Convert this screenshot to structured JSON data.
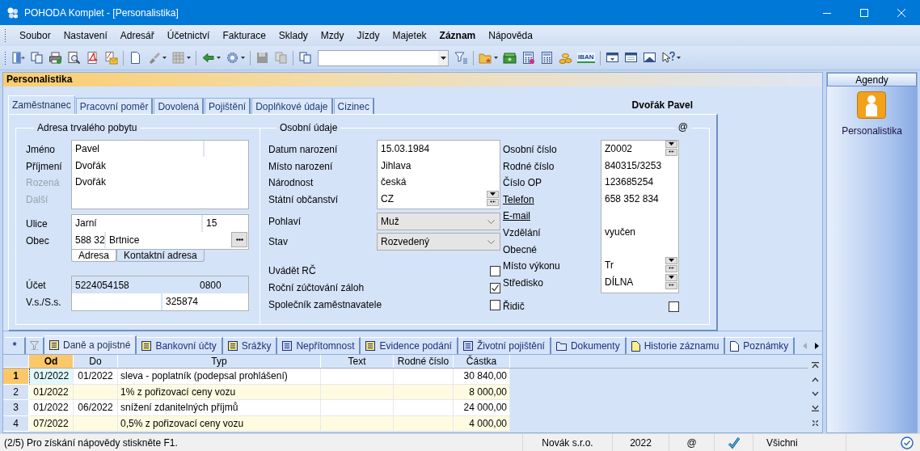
{
  "window": {
    "title": "POHODA Komplet - [Personalistika]"
  },
  "menu": [
    {
      "label": "Soubor",
      "emphasized": false
    },
    {
      "label": "Nastavení",
      "emphasized": false
    },
    {
      "label": "Adresář",
      "emphasized": false
    },
    {
      "label": "Účetnictví",
      "emphasized": false
    },
    {
      "label": "Fakturace",
      "emphasized": false
    },
    {
      "label": "Sklady",
      "emphasized": false
    },
    {
      "label": "Mzdy",
      "emphasized": false
    },
    {
      "label": "Jízdy",
      "emphasized": false
    },
    {
      "label": "Majetek",
      "emphasized": false
    },
    {
      "label": "Záznam",
      "emphasized": true
    },
    {
      "label": "Nápověda",
      "emphasized": false
    }
  ],
  "toolbar": {
    "iban_label": "IBAN"
  },
  "agenda_title": "Personalistika",
  "tabs": [
    {
      "label": "Zaměstnanec",
      "selected": true
    },
    {
      "label": "Pracovní poměr",
      "selected": false
    },
    {
      "label": "Dovolená",
      "selected": false
    },
    {
      "label": "Pojištění",
      "selected": false
    },
    {
      "label": "Doplňkové údaje",
      "selected": false
    },
    {
      "label": "Cizinec",
      "selected": false
    }
  ],
  "employee_name": "Dvořák Pavel",
  "address": {
    "title": "Adresa trvalého pobytu",
    "name_rows": [
      {
        "label": "Jméno",
        "disabled": false,
        "value": "Pavel"
      },
      {
        "label": "Příjmení",
        "disabled": false,
        "value": "Dvořák"
      },
      {
        "label": "Rozená",
        "disabled": true,
        "value": "Dvořák"
      },
      {
        "label": "Další",
        "disabled": true
      }
    ],
    "street_label": "Ulice",
    "street": "Jarní",
    "house_number": "15",
    "city_label": "Obec",
    "zip": "588 32",
    "city": "Brtnice",
    "subtabs": [
      {
        "label": "Adresa",
        "selected": true
      },
      {
        "label": "Kontaktní adresa",
        "selected": false
      }
    ],
    "account_label": "Účet",
    "account": "5224054158",
    "bank_code": "0800",
    "symbol_label": "V.s./S.s.",
    "specific_symbol": "325874"
  },
  "personal": {
    "title": "Osobní údaje",
    "marker": "@",
    "fields": [
      {
        "label": "Datum narození",
        "value": "15.03.1984",
        "picker": false
      },
      {
        "label": "Místo narození",
        "value": "Jihlava",
        "picker": false
      },
      {
        "label": "Národnost",
        "value": "česká",
        "picker": false
      },
      {
        "label": "Státní občanství",
        "value": "CZ",
        "picker": true
      }
    ],
    "selects": [
      {
        "label": "Pohlaví",
        "value": "Muž"
      },
      {
        "label": "Stav",
        "value": "Rozvedený"
      }
    ],
    "checks": [
      {
        "label": "Uvádět RČ",
        "checked": false
      },
      {
        "label": "Roční zúčtování záloh",
        "checked": true
      },
      {
        "label": "Společník zaměstnavatele",
        "checked": false
      }
    ]
  },
  "identity": {
    "fields": [
      {
        "label": "Osobní číslo",
        "value": "Z0002",
        "picker": true,
        "link": false
      },
      {
        "label": "Rodné číslo",
        "value": "840315/3253",
        "picker": false,
        "link": false
      },
      {
        "label": "Číslo OP",
        "value": "123685254",
        "picker": false,
        "link": false
      },
      {
        "label": "Telefon",
        "value": "658 352 834",
        "picker": false,
        "link": true
      },
      {
        "label": "E-mail",
        "picker": false,
        "link": true
      },
      {
        "label": "Vzdělání",
        "value": "vyučen",
        "picker": false,
        "link": false
      },
      {
        "label": "Obecné",
        "picker": false,
        "link": false
      },
      {
        "label": "Místo výkonu",
        "value": "Tr",
        "picker": true,
        "link": false
      },
      {
        "label": "Středisko",
        "value": "DÍLNA",
        "picker": true,
        "link": false
      }
    ],
    "checks": [
      {
        "label": "Řidič",
        "checked": false
      }
    ]
  },
  "bottom_tabs": {
    "new_label": "*",
    "items": [
      {
        "label": "Daně a pojistné",
        "kind": "list",
        "color": "#f3e57a",
        "selected": true
      },
      {
        "label": "Bankovní účty",
        "kind": "list",
        "color": "#f3e57a",
        "selected": false
      },
      {
        "label": "Srážky",
        "kind": "list",
        "color": "#f3e57a",
        "selected": false
      },
      {
        "label": "Nepřítomnost",
        "kind": "list",
        "color": "#c9d9f7",
        "selected": false
      },
      {
        "label": "Evidence podání",
        "kind": "list",
        "color": "#f3e57a",
        "selected": false
      },
      {
        "label": "Životní pojištění",
        "kind": "list",
        "color": "#c9d9f7",
        "selected": false
      },
      {
        "label": "Dokumenty",
        "kind": "folder",
        "color": "#dfe9fb",
        "selected": false
      },
      {
        "label": "Historie záznamu",
        "kind": "page",
        "color": "#fbef86",
        "selected": false
      },
      {
        "label": "Poznámky",
        "kind": "page",
        "color": "#ffffff",
        "selected": false
      }
    ]
  },
  "grid": {
    "columns": [
      {
        "label": "Od",
        "selected": true
      },
      {
        "label": "Do",
        "selected": false
      },
      {
        "label": "Typ",
        "selected": false
      },
      {
        "label": "Text",
        "selected": false
      },
      {
        "label": "Rodné číslo",
        "selected": false
      },
      {
        "label": "Částka",
        "selected": false
      }
    ],
    "rows": [
      {
        "number": "1",
        "selected": true,
        "from": "01/2022",
        "to": "01/2022",
        "type": "sleva - poplatník (podepsal prohlášení)",
        "amount": "30 840,00"
      },
      {
        "number": "2",
        "selected": false,
        "from": "01/2022",
        "type": "1% z pořizovací ceny vozu",
        "amount": "8 000,00"
      },
      {
        "number": "3",
        "selected": false,
        "from": "01/2022",
        "to": "06/2022",
        "type": "snížení zdanitelných příjmů",
        "amount": "24 000,00"
      },
      {
        "number": "4",
        "selected": false,
        "from": "07/2022",
        "type": "0,5% z pořizovací ceny vozu",
        "amount": "4 000,00"
      }
    ]
  },
  "sidebar": {
    "title": "Agendy",
    "items": [
      {
        "label": "Personalistika"
      }
    ]
  },
  "status_bar": {
    "hint": "(2/5) Pro získání nápovědy stiskněte F1.",
    "company": "Novák s.r.o.",
    "year": "2022",
    "mail": "@",
    "filter": "Všichni"
  }
}
